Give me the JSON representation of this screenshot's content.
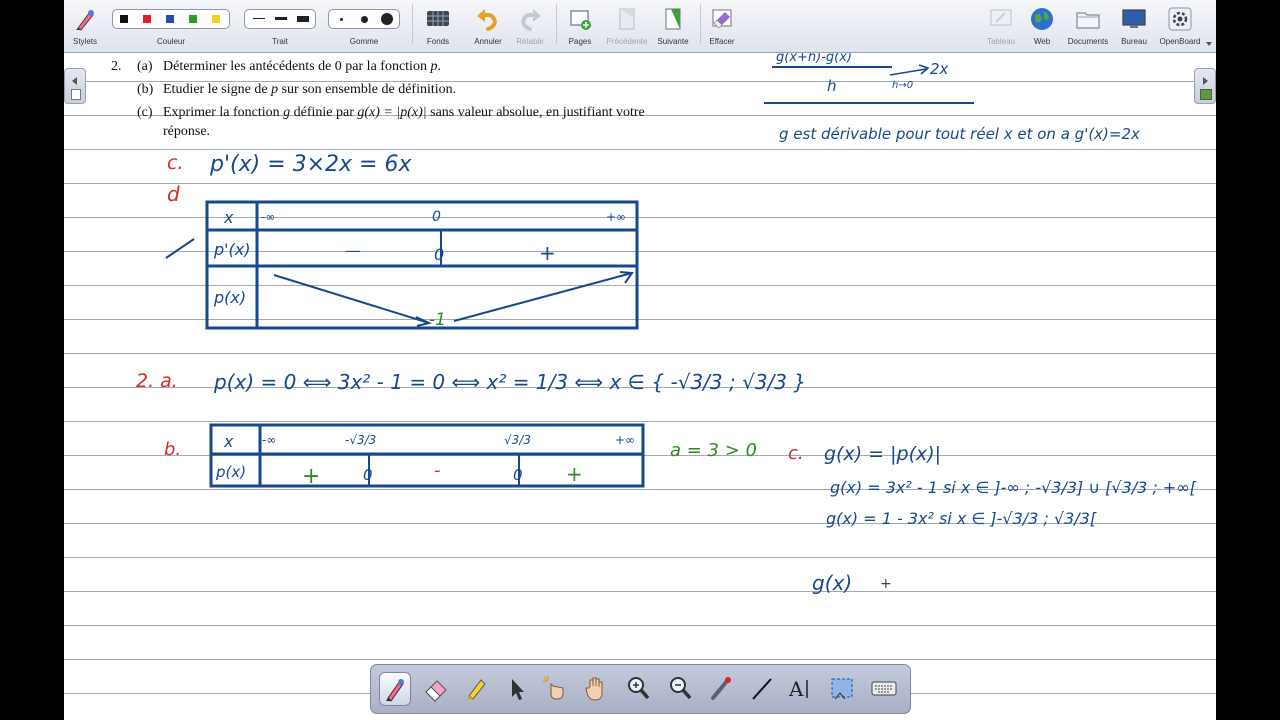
{
  "toolbar": {
    "stylets": "Stylets",
    "couleur": "Couleur",
    "trait": "Trait",
    "gomme": "Gomme",
    "fonds": "Fonds",
    "annuler": "Annuler",
    "retablir": "Rétablir",
    "pages": "Pages",
    "precedente": "Précédente",
    "suivante": "Suivante",
    "effacer": "Effacer",
    "tableau": "Tableau",
    "web": "Web",
    "documents": "Documents",
    "bureau": "Bureau",
    "openboard": "OpenBoard",
    "colors": [
      "#111111",
      "#e0202a",
      "#1f4ea8",
      "#2e9a2a",
      "#f2d22a"
    ]
  },
  "exercise": {
    "number": "2.",
    "a_label": "(a)",
    "a_text": "Déterminer les antécédents de 0 par la fonction ",
    "a_var": "p",
    "a_end": ".",
    "b_label": "(b)",
    "b_text_1": "Etudier le signe de ",
    "b_var": "p",
    "b_text_2": " sur son ensemble de définition.",
    "c_label": "(c)",
    "c_text_1": "Exprimer la fonction ",
    "c_var": "g",
    "c_text_2": " définie par ",
    "c_formula": "g(x) = |p(x)|",
    "c_text_3": " sans valeur absolue, en justifiant votre",
    "c_text_4": "réponse."
  },
  "handwriting": {
    "derivative": "p'(x) = 3×2x = 6x",
    "c_label": "c.",
    "d_label": "d",
    "table1": {
      "x_label": "x",
      "x_values": [
        "-∞",
        "0",
        "+∞"
      ],
      "row1": "p'(x)",
      "signs": [
        "—",
        "0",
        "+"
      ],
      "row2": "p(x)",
      "min": "-1"
    },
    "line_2a_label": "2. a.",
    "line_2a": "p(x) = 0 ⟺ 3x² - 1 = 0 ⟺ x² = 1/3 ⟺ x ∈ { -√3/3 ; √3/3 }",
    "b_label": "b.",
    "table2": {
      "x_label": "x",
      "x_values": [
        "-∞",
        "-√3/3",
        "√3/3",
        "+∞"
      ],
      "row": "p(x)",
      "signs": [
        "+",
        "0",
        "-",
        "0",
        "+"
      ]
    },
    "a_positive": "a = 3 > 0",
    "right_c_label": "c.",
    "g_def": "g(x) = |p(x)|",
    "g_case1": "g(x) = 3x² - 1   si x ∈ ]-∞ ; -√3/3] ∪ [√3/3 ; +∞[",
    "g_case2": "g(x) = 1 - 3x²   si x ∈ ]-√3/3 ; √3/3[",
    "g_start": "g(x)",
    "top_right_1": "(g(x+h) - g(x)) / h  →  2x  (h → 0)",
    "top_right_2": "g est dérivable pour tout réel x et on a g'(x) = 2x"
  },
  "ink_colors": {
    "blue": "#16488f",
    "red": "#d12b2b",
    "green": "#2f8a24"
  }
}
